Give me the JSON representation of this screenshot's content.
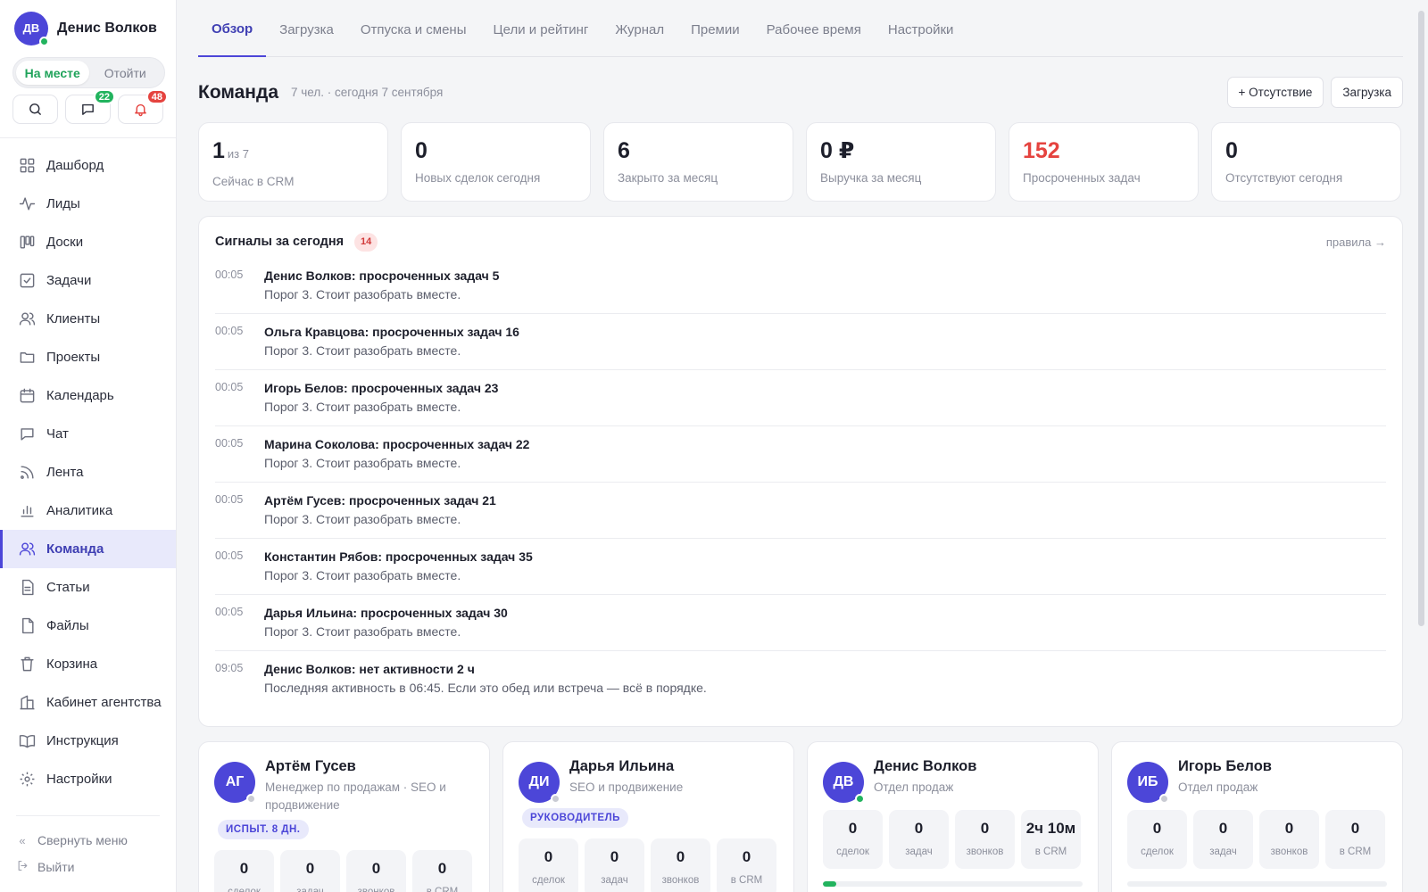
{
  "user": {
    "initials": "ДВ",
    "name": "Денис Волков"
  },
  "status": {
    "present": "На месте",
    "away": "Отойти"
  },
  "quick": {
    "chat_badge": "22",
    "notif_badge": "48"
  },
  "nav": [
    {
      "label": "Дашборд",
      "icon": "dashboard-icon"
    },
    {
      "label": "Лиды",
      "icon": "activity-icon"
    },
    {
      "label": "Доски",
      "icon": "board-icon"
    },
    {
      "label": "Задачи",
      "icon": "task-icon"
    },
    {
      "label": "Клиенты",
      "icon": "users-icon"
    },
    {
      "label": "Проекты",
      "icon": "folder-icon"
    },
    {
      "label": "Календарь",
      "icon": "calendar-icon"
    },
    {
      "label": "Чат",
      "icon": "chat-icon"
    },
    {
      "label": "Лента",
      "icon": "rss-icon"
    },
    {
      "label": "Аналитика",
      "icon": "chart-icon"
    },
    {
      "label": "Команда",
      "icon": "team-icon"
    },
    {
      "label": "Статьи",
      "icon": "article-icon"
    },
    {
      "label": "Файлы",
      "icon": "file-icon"
    },
    {
      "label": "Корзина",
      "icon": "trash-icon"
    },
    {
      "label": "Кабинет агентства",
      "icon": "building-icon"
    },
    {
      "label": "Инструкция",
      "icon": "book-icon"
    },
    {
      "label": "Настройки",
      "icon": "gear-icon"
    }
  ],
  "side_bottom": {
    "collapse": "Свернуть меню",
    "logout": "Выйти"
  },
  "tabs": [
    "Обзор",
    "Загрузка",
    "Отпуска и смены",
    "Цели и рейтинг",
    "Журнал",
    "Премии",
    "Рабочее время",
    "Настройки"
  ],
  "header": {
    "title": "Команда",
    "subtitle": "7 чел. · сегодня 7 сентября",
    "absence_btn": "+ Отсутствие",
    "load_btn": "Загрузка"
  },
  "stats": [
    {
      "value": "1",
      "of": "из 7",
      "label": "Сейчас в CRM"
    },
    {
      "value": "0",
      "label": "Новых сделок сегодня"
    },
    {
      "value": "6",
      "label": "Закрыто за месяц"
    },
    {
      "value": "0 ₽",
      "label": "Выручка за месяц"
    },
    {
      "value": "152",
      "label": "Просроченных задач"
    },
    {
      "value": "0",
      "label": "Отсутствуют сегодня"
    }
  ],
  "signals": {
    "title": "Сигналы за сегодня",
    "count": "14",
    "rules": "правила →",
    "items": [
      {
        "time": "00:05",
        "title": "Денис Волков: просроченных задач 5",
        "desc": "Порог 3. Стоит разобрать вместе."
      },
      {
        "time": "00:05",
        "title": "Ольга Кравцова: просроченных задач 16",
        "desc": "Порог 3. Стоит разобрать вместе."
      },
      {
        "time": "00:05",
        "title": "Игорь Белов: просроченных задач 23",
        "desc": "Порог 3. Стоит разобрать вместе."
      },
      {
        "time": "00:05",
        "title": "Марина Соколова: просроченных задач 22",
        "desc": "Порог 3. Стоит разобрать вместе."
      },
      {
        "time": "00:05",
        "title": "Артём Гусев: просроченных задач 21",
        "desc": "Порог 3. Стоит разобрать вместе."
      },
      {
        "time": "00:05",
        "title": "Константин Рябов: просроченных задач 35",
        "desc": "Порог 3. Стоит разобрать вместе."
      },
      {
        "time": "00:05",
        "title": "Дарья Ильина: просроченных задач 30",
        "desc": "Порог 3. Стоит разобрать вместе."
      },
      {
        "time": "09:05",
        "title": "Денис Волков: нет активности 2 ч",
        "desc": "Последняя активность в 06:45. Если это обед или встреча — всё в порядке."
      }
    ]
  },
  "stat_labels": {
    "deals": "сделок",
    "tasks": "задач",
    "calls": "звонков",
    "crm": "в CRM"
  },
  "members": [
    {
      "initials": "АГ",
      "name": "Артём Гусев",
      "role": "Менеджер по продажам · SEO и продвижение",
      "badge": "ИСПЫТ. 8 ДН.",
      "online": false,
      "deals": "0",
      "tasks": "0",
      "calls": "0",
      "crm": "0"
    },
    {
      "initials": "ДИ",
      "name": "Дарья Ильина",
      "role": "SEO и продвижение",
      "badge": "РУКОВОДИТЕЛЬ",
      "online": false,
      "deals": "0",
      "tasks": "0",
      "calls": "0",
      "crm": "0"
    },
    {
      "initials": "ДВ",
      "name": "Денис Волков",
      "role": "Отдел продаж",
      "online": true,
      "deals": "0",
      "tasks": "0",
      "calls": "0",
      "crm": "2ч 10м",
      "progress": 0.05
    },
    {
      "initials": "ИБ",
      "name": "Игорь Белов",
      "role": "Отдел продаж",
      "online": false,
      "deals": "0",
      "tasks": "0",
      "calls": "0",
      "crm": "0",
      "progress": 0
    }
  ],
  "colors": {
    "accent": "#4c46d8",
    "success": "#22b35e",
    "danger": "#e5433f"
  }
}
